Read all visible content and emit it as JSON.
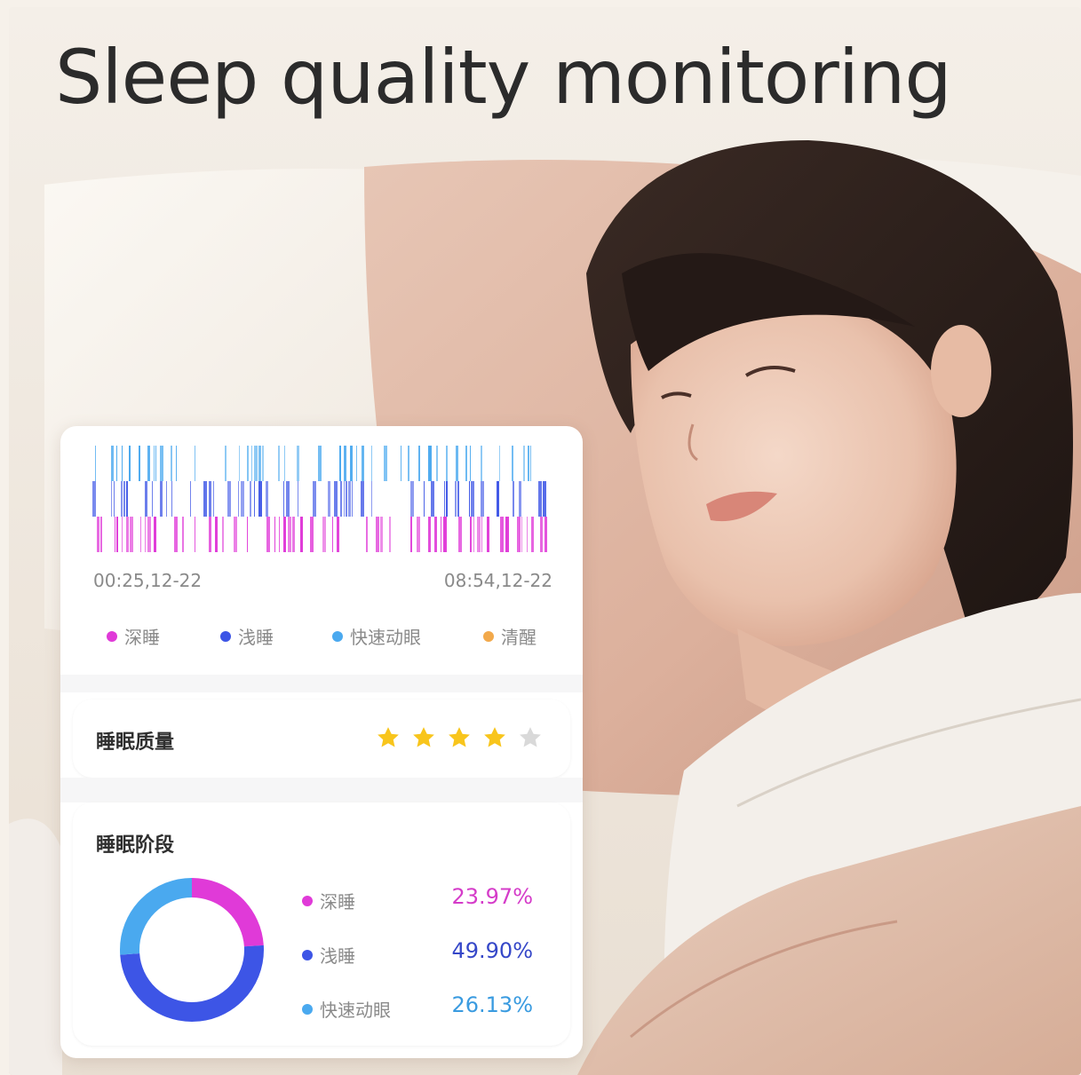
{
  "headline": "Sleep quality monitoring",
  "colors": {
    "deep": "#e03ad8",
    "light": "#3d55e6",
    "rem": "#4aa9ef",
    "awake": "#f2a94b",
    "star_on": "#f8c51c",
    "star_off": "#d9d9d9"
  },
  "hypnogram": {
    "start_time": "00:25,12-22",
    "end_time": "08:54,12-22"
  },
  "legend": [
    {
      "label": "深睡",
      "color": "#e03ad8"
    },
    {
      "label": "浅睡",
      "color": "#3d55e6"
    },
    {
      "label": "快速动眼",
      "color": "#4aa9ef"
    },
    {
      "label": "清醒",
      "color": "#f2a94b"
    }
  ],
  "quality": {
    "title": "睡眠质量",
    "rating": 4,
    "max": 5
  },
  "stages": {
    "title": "睡眠阶段",
    "items": [
      {
        "label": "深睡",
        "value": "23.97%",
        "percent": 23.97,
        "color": "#e03ad8"
      },
      {
        "label": "浅睡",
        "value": "49.90%",
        "percent": 49.9,
        "color": "#3d55e6"
      },
      {
        "label": "快速动眼",
        "value": "26.13%",
        "percent": 26.13,
        "color": "#4aa9ef"
      }
    ]
  }
}
